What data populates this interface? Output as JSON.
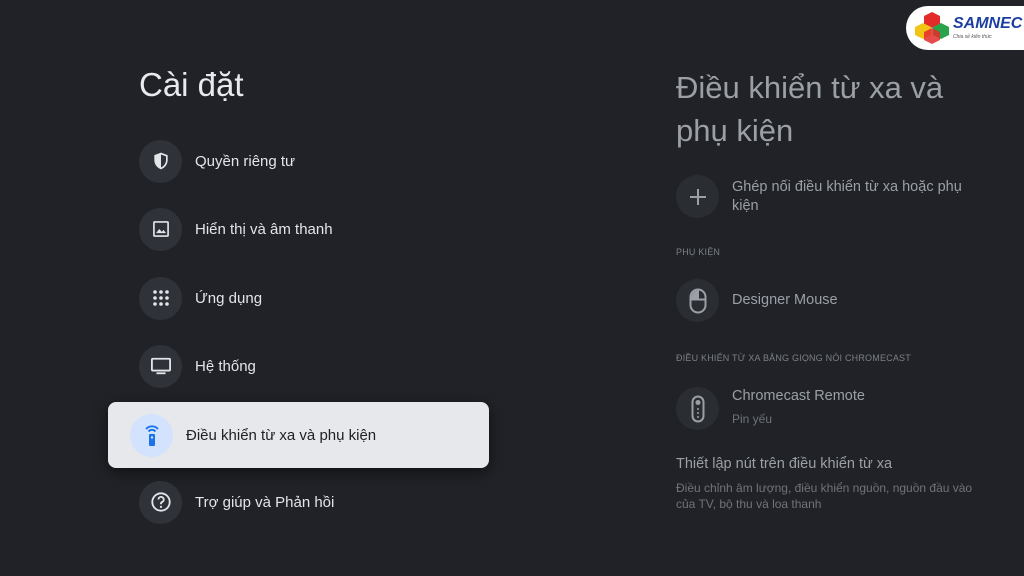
{
  "brand": {
    "name": "SAMNEC",
    "tagline": "Chia sẻ kiến thức"
  },
  "left": {
    "title": "Cài đặt",
    "items": [
      {
        "label": "Quyền riêng tư",
        "icon": "shield-icon"
      },
      {
        "label": "Hiển thị và âm thanh",
        "icon": "image-icon"
      },
      {
        "label": "Ứng dụng",
        "icon": "apps-grid-icon"
      },
      {
        "label": "Hệ thống",
        "icon": "tv-icon"
      },
      {
        "label": "Điều khiển từ xa và phụ kiện",
        "icon": "remote-icon",
        "selected": true
      },
      {
        "label": "Trợ giúp và Phản hồi",
        "icon": "help-icon"
      }
    ]
  },
  "right": {
    "title": "Điều khiển từ xa và phụ kiện",
    "pair": {
      "label": "Ghép nối điều khiển từ xa hoặc phụ kiện"
    },
    "accessories_header": "PHỤ KIỆN",
    "accessory": {
      "label": "Designer Mouse"
    },
    "voice_header": "ĐIỀU KHIỂN TỪ XA BẰNG GIỌNG NÓI CHROMECAST",
    "remote": {
      "label": "Chromecast Remote",
      "status": "Pin yếu"
    },
    "setup": {
      "title": "Thiết lập nút trên điều khiển từ xa",
      "description": "Điều chỉnh âm lượng, điều khiển nguồn, nguồn đầu vào của TV, bộ thu và loa thanh"
    }
  },
  "colors": {
    "background": "#202227",
    "selected_bg": "#e7e8ec",
    "accent_blue": "#1a73e8"
  }
}
